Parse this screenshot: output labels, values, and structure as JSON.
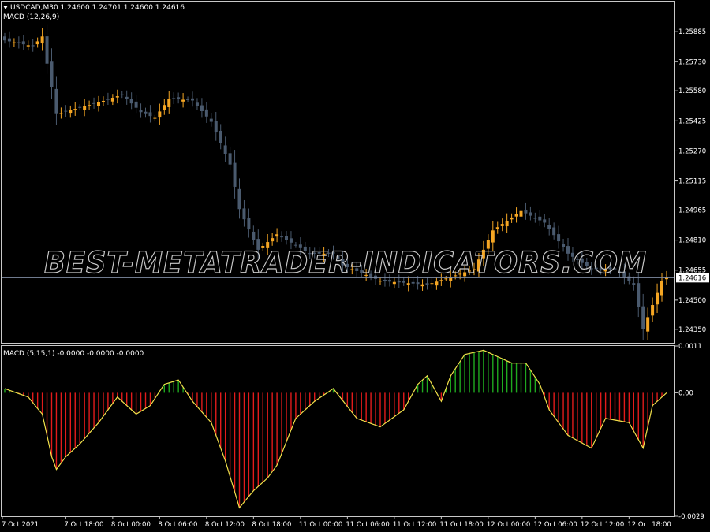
{
  "header": {
    "symbol_line": "USDCAD,M30  1.24600 1.24701 1.24600 1.24616",
    "indicator_line": "MACD (12,26,9)"
  },
  "watermark": "BEST-METATRADER-INDICATORS.COM",
  "colors": {
    "background": "#000000",
    "frame": "#c8c8c8",
    "bull_candle": "#f5a623",
    "bear_candle": "#4a5a6e",
    "price_line": "#7f8ba3",
    "hist_positive": "#1faa1f",
    "hist_negative": "#e21b1b",
    "signal_line": "#f1e04a"
  },
  "chart_data": [
    {
      "type": "candlestick",
      "title": "USDCAD,M30",
      "ohlc_readout": {
        "open": 1.246,
        "high": 1.24701,
        "low": 1.246,
        "close": 1.24616
      },
      "ylim": [
        1.2428,
        1.2604
      ],
      "y_ticks": [
        "1.25885",
        "1.25730",
        "1.25580",
        "1.25425",
        "1.25270",
        "1.25115",
        "1.24965",
        "1.24810",
        "1.24655",
        "1.24500",
        "1.24350"
      ],
      "y_tick_values": [
        1.25885,
        1.2573,
        1.2558,
        1.25425,
        1.2527,
        1.25115,
        1.24965,
        1.2481,
        1.24655,
        1.245,
        1.2435
      ],
      "current_price": 1.24616,
      "current_price_label": "1.24616",
      "bars": 142,
      "anchors": [
        [
          0,
          1.2584
        ],
        [
          6,
          1.2581
        ],
        [
          8,
          1.2586
        ],
        [
          9,
          1.2572
        ],
        [
          10,
          1.256
        ],
        [
          11,
          1.2546
        ],
        [
          14,
          1.2548
        ],
        [
          20,
          1.2552
        ],
        [
          25,
          1.2556
        ],
        [
          29,
          1.2547
        ],
        [
          32,
          1.2544
        ],
        [
          35,
          1.2554
        ],
        [
          40,
          1.2553
        ],
        [
          44,
          1.2542
        ],
        [
          48,
          1.252
        ],
        [
          50,
          1.2497
        ],
        [
          54,
          1.2476
        ],
        [
          58,
          1.2484
        ],
        [
          65,
          1.2474
        ],
        [
          70,
          1.2474
        ],
        [
          72,
          1.2468
        ],
        [
          80,
          1.246
        ],
        [
          90,
          1.2458
        ],
        [
          100,
          1.2466
        ],
        [
          104,
          1.2486
        ],
        [
          110,
          1.2496
        ],
        [
          115,
          1.249
        ],
        [
          120,
          1.2474
        ],
        [
          125,
          1.2466
        ],
        [
          130,
          1.2466
        ],
        [
          134,
          1.2458
        ],
        [
          136,
          1.2435
        ],
        [
          140,
          1.246
        ],
        [
          141,
          1.24616
        ]
      ]
    },
    {
      "type": "histogram+line",
      "title": "MACD (5,15,1)",
      "readout": "MACD (5,15,1) -0.0000 -0.0000 -0.0000",
      "ylim": [
        -0.0029,
        0.0011
      ],
      "y_ticks": [
        "0.0011",
        "0.00",
        "-0.0029"
      ],
      "y_tick_values": [
        0.0011,
        0.0,
        -0.0029
      ],
      "bars": 142,
      "anchors": [
        [
          0,
          0.0001
        ],
        [
          5,
          -0.0001
        ],
        [
          8,
          -0.0005
        ],
        [
          10,
          -0.0015
        ],
        [
          11,
          -0.0018
        ],
        [
          13,
          -0.0015
        ],
        [
          16,
          -0.0012
        ],
        [
          20,
          -0.0007
        ],
        [
          24,
          -0.0001
        ],
        [
          28,
          -0.0005
        ],
        [
          31,
          -0.0003
        ],
        [
          34,
          0.0002
        ],
        [
          37,
          0.0003
        ],
        [
          40,
          -0.0002
        ],
        [
          44,
          -0.0007
        ],
        [
          47,
          -0.0016
        ],
        [
          50,
          -0.0027
        ],
        [
          53,
          -0.0023
        ],
        [
          56,
          -0.002
        ],
        [
          58,
          -0.0017
        ],
        [
          62,
          -0.0006
        ],
        [
          66,
          -0.0002
        ],
        [
          70,
          0.0001
        ],
        [
          75,
          -0.0006
        ],
        [
          80,
          -0.0008
        ],
        [
          85,
          -0.0004
        ],
        [
          88,
          0.0002
        ],
        [
          90,
          0.0004
        ],
        [
          93,
          -0.0002
        ],
        [
          95,
          0.0004
        ],
        [
          98,
          0.0009
        ],
        [
          102,
          0.001
        ],
        [
          108,
          0.0007
        ],
        [
          111,
          0.0007
        ],
        [
          114,
          0.0002
        ],
        [
          116,
          -0.0004
        ],
        [
          120,
          -0.001
        ],
        [
          125,
          -0.0013
        ],
        [
          128,
          -0.0006
        ],
        [
          133,
          -0.0007
        ],
        [
          136,
          -0.0013
        ],
        [
          138,
          -0.0003
        ],
        [
          141,
          0.0
        ]
      ]
    }
  ],
  "time_axis": [
    {
      "label": "7 Oct 2021",
      "bar": 0
    },
    {
      "label": "7 Oct 18:00",
      "bar": 13
    },
    {
      "label": "8 Oct 00:00",
      "bar": 23
    },
    {
      "label": "8 Oct 06:00",
      "bar": 33
    },
    {
      "label": "8 Oct 12:00",
      "bar": 43
    },
    {
      "label": "8 Oct 18:00",
      "bar": 53
    },
    {
      "label": "11 Oct 00:00",
      "bar": 63
    },
    {
      "label": "11 Oct 06:00",
      "bar": 73
    },
    {
      "label": "11 Oct 12:00",
      "bar": 83
    },
    {
      "label": "11 Oct 18:00",
      "bar": 93
    },
    {
      "label": "12 Oct 00:00",
      "bar": 103
    },
    {
      "label": "12 Oct 06:00",
      "bar": 113
    },
    {
      "label": "12 Oct 12:00",
      "bar": 123
    },
    {
      "label": "12 Oct 18:00",
      "bar": 133
    }
  ]
}
